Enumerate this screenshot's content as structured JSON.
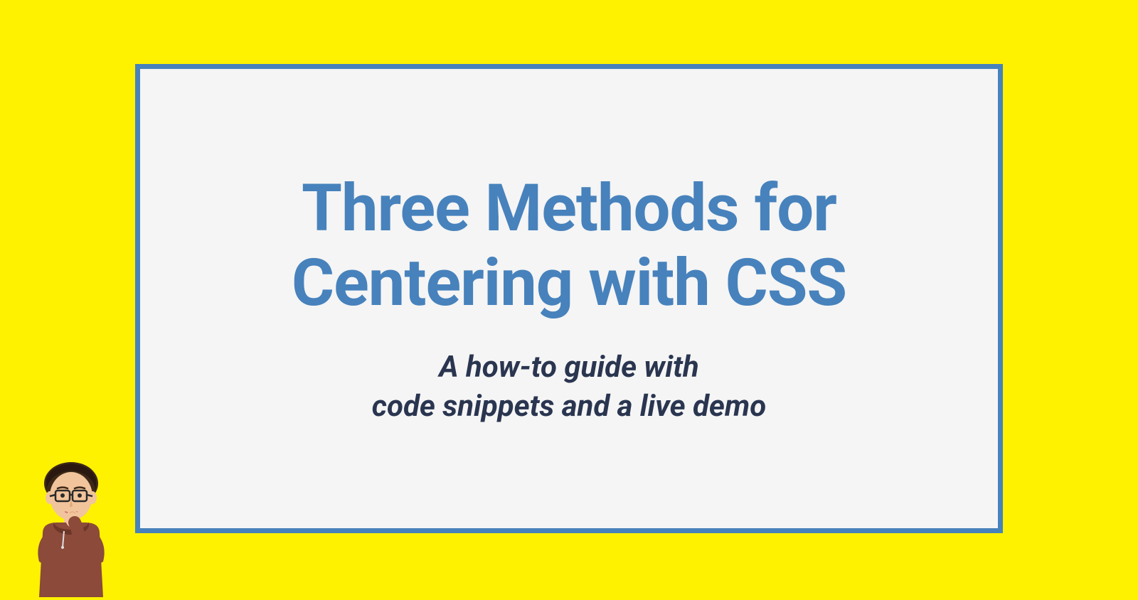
{
  "card": {
    "title": "Three Methods for Centering with CSS",
    "subtitle_line1": "A how-to guide with",
    "subtitle_line2": "code snippets and a live demo"
  },
  "colors": {
    "background": "#fff200",
    "card_bg": "#f5f5f5",
    "border": "#4782bc",
    "title": "#4782bc",
    "subtitle": "#2a3550"
  }
}
